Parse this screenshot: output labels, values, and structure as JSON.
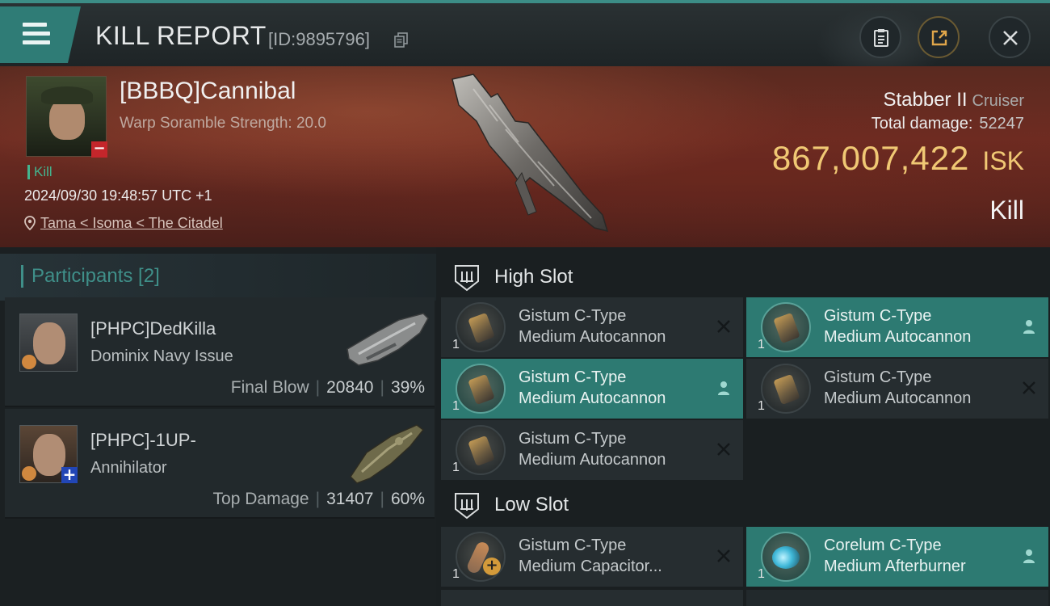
{
  "header": {
    "title": "KILL REPORT",
    "report_id": "[ID:9895796]",
    "icons": [
      "menu-icon",
      "copy-icon",
      "clipboard-icon",
      "share-icon",
      "close-icon"
    ]
  },
  "victim": {
    "name": "[BBBQ]Cannibal",
    "warp_scramble": "Warp Soramble Strength: 20.0",
    "tag": "Kill",
    "datetime": "2024/09/30 19:48:57 UTC +1",
    "location": "Tama < Isoma < The Citadel",
    "ship_name": "Stabber II",
    "ship_class": "Cruiser",
    "total_damage_label": "Total damage:",
    "total_damage_value": "52247",
    "isk_amount": "867,007,422",
    "isk_unit": "ISK",
    "result": "Kill"
  },
  "participants": {
    "title": "Participants [2]",
    "rows": [
      {
        "name": "[PHPC]DedKilla",
        "ship": "Dominix Navy Issue",
        "label": "Final Blow",
        "damage": "20840",
        "percent": "39%"
      },
      {
        "name": "[PHPC]-1UP-",
        "ship": "Annihilator",
        "label": "Top Damage",
        "damage": "31407",
        "percent": "60%"
      }
    ]
  },
  "fitting": {
    "high_slot_label": "High Slot",
    "low_slot_label": "Low Slot",
    "high": [
      {
        "qty": "1",
        "line1": "Gistum C-Type",
        "line2": "Medium Autocannon",
        "status": "destroyed"
      },
      {
        "qty": "1",
        "line1": "Gistum C-Type",
        "line2": "Medium Autocannon",
        "status": "dropped"
      },
      {
        "qty": "1",
        "line1": "Gistum C-Type",
        "line2": "Medium Autocannon",
        "status": "dropped"
      },
      {
        "qty": "1",
        "line1": "Gistum C-Type",
        "line2": "Medium Autocannon",
        "status": "destroyed"
      },
      {
        "qty": "1",
        "line1": "Gistum C-Type",
        "line2": "Medium Autocannon",
        "status": "destroyed"
      }
    ],
    "low": [
      {
        "qty": "1",
        "line1": "Gistum C-Type",
        "line2": "Medium Capacitor...",
        "status": "destroyed"
      },
      {
        "qty": "1",
        "line1": "Corelum C-Type",
        "line2": "Medium Afterburner",
        "status": "dropped"
      }
    ]
  },
  "colors": {
    "accent_teal": "#2d7a72",
    "isk_gold": "#f0c874",
    "kill_green": "#43b58f",
    "minus_red": "#c4262b",
    "plus_blue": "#2246b6"
  }
}
